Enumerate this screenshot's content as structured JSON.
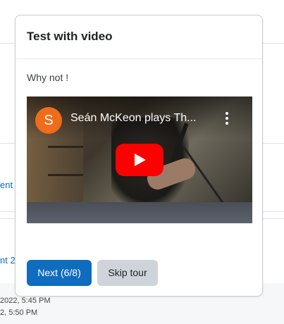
{
  "background": {
    "links": [
      "ent",
      "nt 2"
    ],
    "dates": [
      "2022, 5:45 PM",
      "2, 5:50 PM"
    ]
  },
  "tour": {
    "title": "Test with video",
    "body": "Why not !",
    "video": {
      "channel_initial": "S",
      "title": "Seán McKeon plays Th...",
      "play_icon": "youtube-play-icon",
      "menu_icon": "more-vert-icon"
    },
    "next_label": "Next (6/8)",
    "skip_label": "Skip tour"
  },
  "colors": {
    "primary": "#0f6cbf",
    "secondary": "#ced4da",
    "youtube_red": "#ff0000",
    "avatar_orange": "#ef6c1a"
  }
}
